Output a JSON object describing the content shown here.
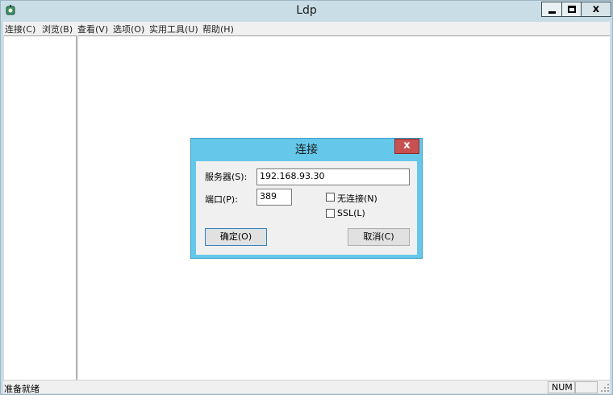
{
  "window": {
    "title": "Ldp",
    "app_icon": "ldp-app-icon",
    "controls": {
      "minimize": "minimize-icon",
      "maximize": "maximize-icon",
      "close_glyph": "x"
    }
  },
  "menu": {
    "items": [
      {
        "label": "连接(C)"
      },
      {
        "label": "浏览(B)"
      },
      {
        "label": "查看(V)"
      },
      {
        "label": "选项(O)"
      },
      {
        "label": "实用工具(U)"
      },
      {
        "label": "帮助(H)"
      }
    ]
  },
  "statusbar": {
    "text": "准备就绪",
    "num": "NUM"
  },
  "dialog": {
    "title": "连接",
    "close_glyph": "x",
    "server_label": "服务器(S):",
    "server_value": "192.168.93.30",
    "port_label": "端口(P):",
    "port_value": "389",
    "connectionless_label": "无连接(N)",
    "connectionless_checked": false,
    "ssl_label": "SSL(L)",
    "ssl_checked": false,
    "ok_label": "确定(O)",
    "cancel_label": "取消(C)"
  },
  "colors": {
    "title_bar": "#c9dde6",
    "dialog_frame": "#65c7ea",
    "dialog_close": "#c75050",
    "face": "#f0f0f0"
  }
}
